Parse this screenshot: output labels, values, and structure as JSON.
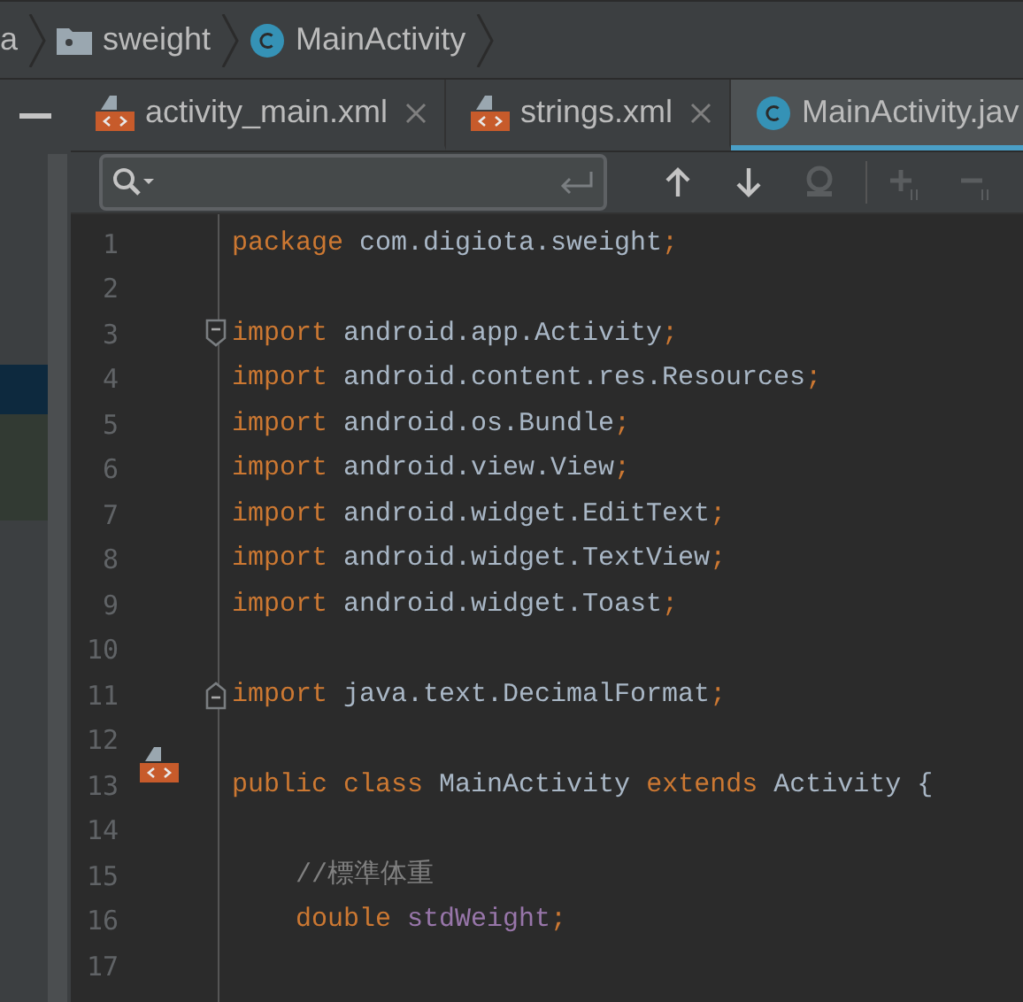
{
  "breadcrumbs": [
    {
      "label": "a",
      "kind": "package"
    },
    {
      "label": "sweight",
      "kind": "folder"
    },
    {
      "label": "MainActivity",
      "kind": "class"
    }
  ],
  "tabs": [
    {
      "label": "activity_main.xml",
      "kind": "xml",
      "selected": false,
      "closable": true
    },
    {
      "label": "strings.xml",
      "kind": "xml",
      "selected": false,
      "closable": true
    },
    {
      "label": "MainActivity.jav",
      "kind": "class",
      "selected": true,
      "closable": false
    }
  ],
  "toolbar": {
    "buttons": [
      {
        "kind": "up",
        "disabled": false
      },
      {
        "kind": "down",
        "disabled": false
      },
      {
        "kind": "word",
        "disabled": true
      },
      {
        "kind": "add",
        "disabled": true
      },
      {
        "kind": "remove",
        "disabled": true
      }
    ]
  },
  "project_panel": {
    "rows": [
      {
        "kind": "selected"
      },
      {
        "kind": "changed"
      }
    ]
  },
  "editor": {
    "lines": [
      {
        "number": "1",
        "code": [
          {
            "text": "package",
            "kind": "keyword"
          },
          {
            "text": " com.digiota.sweight",
            "kind": "plain"
          },
          {
            "text": ";",
            "kind": "keyword"
          }
        ]
      },
      {
        "number": "2"
      },
      {
        "number": "3",
        "kind": "fold-start",
        "code": [
          {
            "text": "import",
            "kind": "keyword"
          },
          {
            "text": " android.app.Activity",
            "kind": "plain"
          },
          {
            "text": ";",
            "kind": "keyword"
          }
        ]
      },
      {
        "number": "4",
        "code": [
          {
            "text": "import",
            "kind": "keyword"
          },
          {
            "text": " android.content.res.Resources",
            "kind": "plain"
          },
          {
            "text": ";",
            "kind": "keyword"
          }
        ]
      },
      {
        "number": "5",
        "code": [
          {
            "text": "import",
            "kind": "keyword"
          },
          {
            "text": " android.os.Bundle",
            "kind": "plain"
          },
          {
            "text": ";",
            "kind": "keyword"
          }
        ]
      },
      {
        "number": "6",
        "code": [
          {
            "text": "import",
            "kind": "keyword"
          },
          {
            "text": " android.view.View",
            "kind": "plain"
          },
          {
            "text": ";",
            "kind": "keyword"
          }
        ]
      },
      {
        "number": "7",
        "code": [
          {
            "text": "import",
            "kind": "keyword"
          },
          {
            "text": " android.widget.EditText",
            "kind": "plain"
          },
          {
            "text": ";",
            "kind": "keyword"
          }
        ]
      },
      {
        "number": "8",
        "code": [
          {
            "text": "import",
            "kind": "keyword"
          },
          {
            "text": " android.widget.TextView",
            "kind": "plain"
          },
          {
            "text": ";",
            "kind": "keyword"
          }
        ]
      },
      {
        "number": "9",
        "code": [
          {
            "text": "import",
            "kind": "keyword"
          },
          {
            "text": " android.widget.Toast",
            "kind": "plain"
          },
          {
            "text": ";",
            "kind": "keyword"
          }
        ]
      },
      {
        "number": "10"
      },
      {
        "number": "11",
        "kind": "fold-end",
        "code": [
          {
            "text": "import",
            "kind": "keyword"
          },
          {
            "text": " java.text.DecimalFormat",
            "kind": "plain"
          },
          {
            "text": ";",
            "kind": "keyword"
          }
        ]
      },
      {
        "number": "12"
      },
      {
        "number": "13",
        "kind": "layout",
        "code": [
          {
            "text": "public class",
            "kind": "keyword"
          },
          {
            "text": " MainActivity ",
            "kind": "plain"
          },
          {
            "text": "extends",
            "kind": "keyword"
          },
          {
            "text": " Activity {",
            "kind": "plain"
          }
        ]
      },
      {
        "number": "14"
      },
      {
        "number": "15",
        "indent": true,
        "code": [
          {
            "text": "//標準体重",
            "kind": "comment"
          }
        ]
      },
      {
        "number": "16",
        "indent": true,
        "code": [
          {
            "text": "double",
            "kind": "keyword"
          },
          {
            "text": " stdWeight",
            "kind": "field"
          },
          {
            "text": ";",
            "kind": "keyword"
          }
        ]
      },
      {
        "number": "17"
      }
    ]
  }
}
